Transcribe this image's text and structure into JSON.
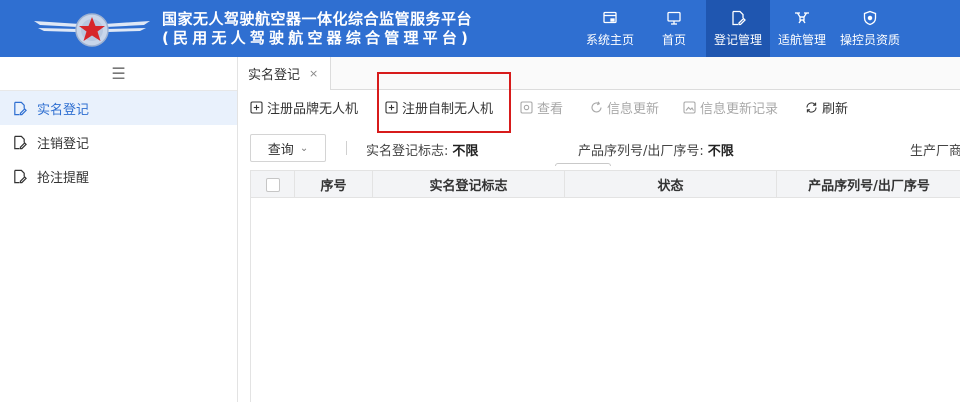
{
  "header": {
    "title_main": "国家无人驾驶航空器一体化综合监管服务平台",
    "title_sub": "(民用无人驾驶航空器综合管理平台)",
    "nav": [
      {
        "id": "system-home",
        "label": "系统主页",
        "icon": "window-icon"
      },
      {
        "id": "home",
        "label": "首页",
        "icon": "monitor-icon"
      },
      {
        "id": "registration",
        "label": "登记管理",
        "icon": "document-edit-icon",
        "active": true
      },
      {
        "id": "airworthiness",
        "label": "适航管理",
        "icon": "drone-icon"
      },
      {
        "id": "operator",
        "label": "操控员资质",
        "icon": "shield-icon"
      }
    ]
  },
  "sidebar": {
    "toggle_icon": "☰",
    "items": [
      {
        "label": "实名登记",
        "active": true
      },
      {
        "label": "注销登记"
      },
      {
        "label": "抢注提醒"
      }
    ]
  },
  "tabs": [
    {
      "label": "实名登记",
      "close": "×"
    }
  ],
  "toolbar": {
    "register_brand": "注册品牌无人机",
    "register_self_made": "注册自制无人机",
    "view": "查看",
    "info_update": "信息更新",
    "update_records": "信息更新记录",
    "refresh": "刷新"
  },
  "filters": {
    "query_label": "查询",
    "chevron": "⌄",
    "realname_flag_label": "实名登记标志:",
    "realname_flag_value": "不限",
    "serial_label": "产品序列号/出厂序号:",
    "serial_value": "不限",
    "manufacturer_label": "生产厂商"
  },
  "table": {
    "columns": [
      "序号",
      "实名登记标志",
      "状态",
      "产品序列号/出厂序号"
    ],
    "rows": []
  },
  "colors": {
    "header_bg": "#2f6fd1",
    "nav_active_bg": "#1f56b0",
    "highlight_border": "#d71b1b"
  }
}
